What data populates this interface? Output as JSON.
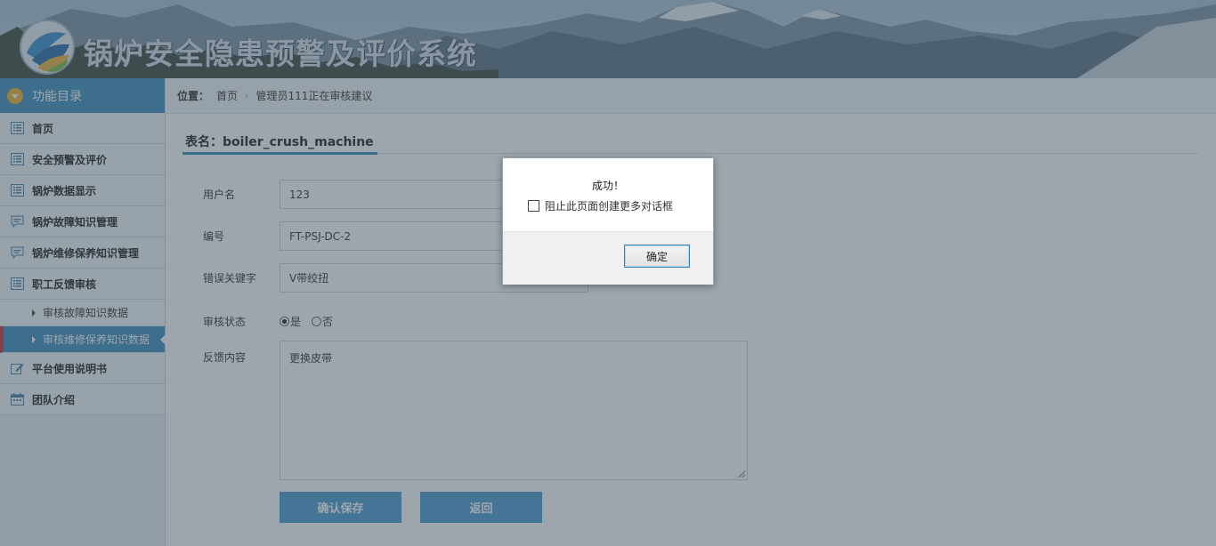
{
  "header": {
    "site_title": "锅炉安全隐患预警及评价系统"
  },
  "sidebar": {
    "heading": "功能目录",
    "items": [
      {
        "label": "首页",
        "icon": "list-icon"
      },
      {
        "label": "安全预警及评价",
        "icon": "list-icon"
      },
      {
        "label": "锅炉数据显示",
        "icon": "list-icon"
      },
      {
        "label": "锅炉故障知识管理",
        "icon": "comment-icon"
      },
      {
        "label": "锅炉维修保养知识管理",
        "icon": "comment-icon"
      },
      {
        "label": "职工反馈审核",
        "icon": "list-icon"
      }
    ],
    "sub_items": [
      {
        "label": "审核故障知识数据"
      },
      {
        "label": "审核维修保养知识数据",
        "active": true
      }
    ],
    "items_after": [
      {
        "label": "平台使用说明书",
        "icon": "edit-icon"
      },
      {
        "label": "团队介绍",
        "icon": "calendar-icon"
      }
    ]
  },
  "breadcrumb": {
    "label": "位置：",
    "home": "首页",
    "current": "管理员111正在审核建议"
  },
  "form": {
    "table_title": "表名：boiler_crush_machine",
    "username_label": "用户名",
    "username_value": "123",
    "code_label": "编号",
    "code_value": "FT-PSJ-DC-2",
    "keyword_label": "错误关键字",
    "keyword_value": "V带绞扭",
    "status_label": "审核状态",
    "status_yes": "是",
    "status_no": "否",
    "feedback_label": "反馈内容",
    "feedback_value": "更换皮带",
    "save_button": "确认保存",
    "back_button": "返回"
  },
  "dialog": {
    "message": "成功！",
    "checkbox_label": "阻止此页面创建更多对话框",
    "ok_button": "确定"
  },
  "colors": {
    "accent": "#3f8fbf",
    "active_marker": "#cc3333",
    "button": "#4d9ad0"
  }
}
